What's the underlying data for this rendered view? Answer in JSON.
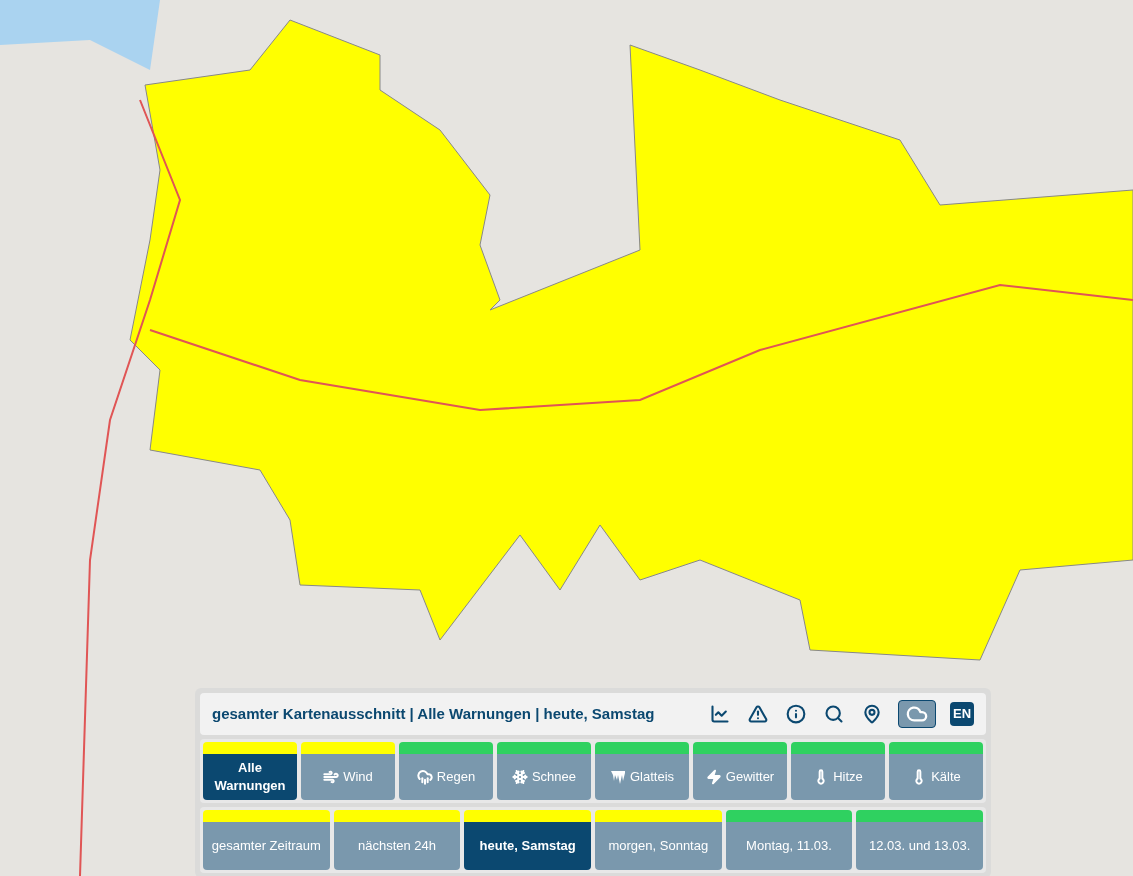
{
  "panel": {
    "title": "gesamter Kartenausschnitt | Alle Warnungen | heute, Samstag",
    "tools": [
      {
        "kind": "chart",
        "selected": false
      },
      {
        "kind": "warning",
        "selected": false
      },
      {
        "kind": "info",
        "selected": false
      },
      {
        "kind": "zoom",
        "selected": false
      },
      {
        "kind": "pin",
        "selected": false
      },
      {
        "kind": "cloud",
        "selected": true
      }
    ],
    "language": "EN",
    "warning_types": [
      {
        "label": "Alle Warnungen",
        "kind": "all",
        "selected": true,
        "color": "#ffff00"
      },
      {
        "label": "Wind",
        "kind": "wind",
        "selected": false,
        "color": "#ffff00"
      },
      {
        "label": "Regen",
        "kind": "rain",
        "selected": false,
        "color": "#2fd160"
      },
      {
        "label": "Schnee",
        "kind": "snow",
        "selected": false,
        "color": "#2fd160"
      },
      {
        "label": "Glatteis",
        "kind": "ice",
        "selected": false,
        "color": "#2fd160"
      },
      {
        "label": "Gewitter",
        "kind": "storm",
        "selected": false,
        "color": "#2fd160"
      },
      {
        "label": "Hitze",
        "kind": "heat",
        "selected": false,
        "color": "#2fd160"
      },
      {
        "label": "Kälte",
        "kind": "cold",
        "selected": false,
        "color": "#2fd160"
      }
    ],
    "periods": [
      {
        "label": "gesamter Zeitraum",
        "selected": false,
        "color": "#ffff00"
      },
      {
        "label": "nächsten 24h",
        "selected": false,
        "color": "#ffff00"
      },
      {
        "label": "heute, Samstag",
        "selected": true,
        "color": "#ffff00"
      },
      {
        "label": "morgen, Sonntag",
        "selected": false,
        "color": "#ffff00"
      },
      {
        "label": "Montag, 11.03.",
        "selected": false,
        "color": "#2fd160"
      },
      {
        "label": "12.03. und 13.03.",
        "selected": false,
        "color": "#2fd160"
      }
    ]
  }
}
